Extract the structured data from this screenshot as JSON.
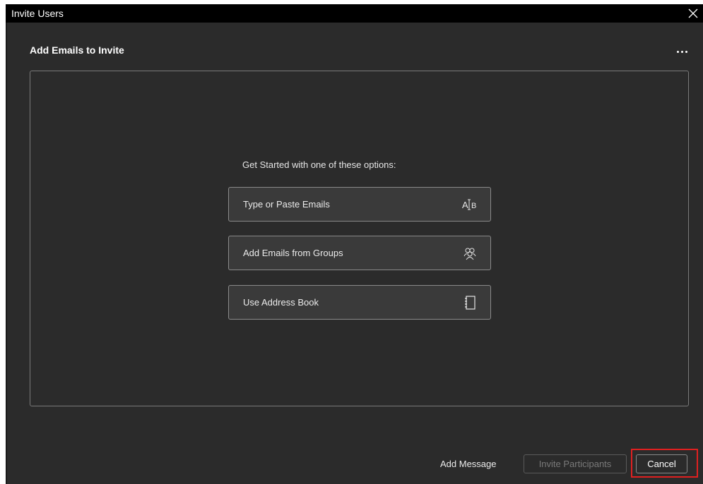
{
  "window": {
    "title": "Invite Users",
    "close_icon": "close-icon"
  },
  "header": {
    "title": "Add Emails to Invite",
    "more_icon": "more-horizontal-icon"
  },
  "main": {
    "prompt": "Get Started with one of these options:",
    "options": [
      {
        "label": "Type or Paste Emails",
        "icon": "text-cursor-ab-icon"
      },
      {
        "label": "Add Emails from Groups",
        "icon": "group-users-icon"
      },
      {
        "label": "Use Address Book",
        "icon": "address-book-icon"
      }
    ]
  },
  "footer": {
    "add_message": "Add Message",
    "invite_label": "Invite Participants",
    "cancel_label": "Cancel"
  },
  "colors": {
    "background": "#2b2b2b",
    "titlebar": "#000000",
    "highlight": "#e02020"
  }
}
